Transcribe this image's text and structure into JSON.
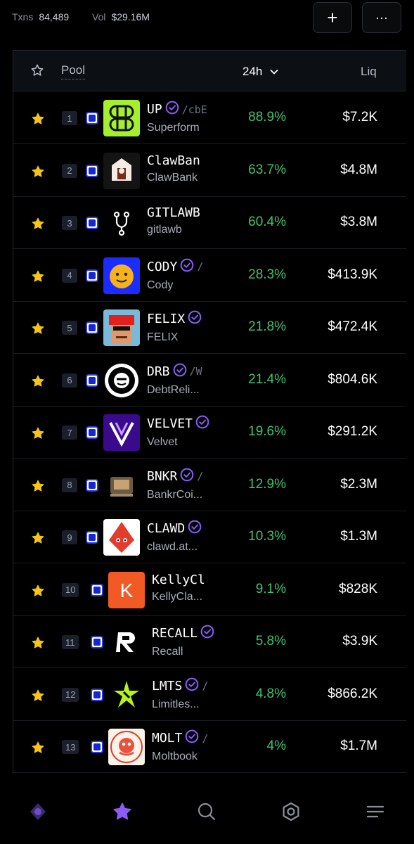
{
  "stats": {
    "txns_label": "Txns",
    "txns_value": "84,489",
    "vol_label": "Vol",
    "vol_value": "$29.16M"
  },
  "buttons": {
    "add": "+",
    "more": "···"
  },
  "table": {
    "col_pool": "Pool",
    "col_change": "24h",
    "col_liq": "Liq"
  },
  "rows": [
    {
      "rank": "1",
      "symbol": "UP",
      "verified": true,
      "suffix": "/cbE",
      "name": "Superform",
      "change": "88.9%",
      "liq": "$7.2K"
    },
    {
      "rank": "2",
      "symbol": "ClawBan",
      "verified": false,
      "suffix": "",
      "name": "ClawBank",
      "change": "63.7%",
      "liq": "$4.8M"
    },
    {
      "rank": "3",
      "symbol": "GITLAWB",
      "verified": false,
      "suffix": "",
      "name": "gitlawb",
      "change": "60.4%",
      "liq": "$3.8M"
    },
    {
      "rank": "4",
      "symbol": "CODY",
      "verified": true,
      "suffix": "/",
      "name": "Cody",
      "change": "28.3%",
      "liq": "$413.9K"
    },
    {
      "rank": "5",
      "symbol": "FELIX",
      "verified": true,
      "suffix": "",
      "name": "FELIX",
      "change": "21.8%",
      "liq": "$472.4K"
    },
    {
      "rank": "6",
      "symbol": "DRB",
      "verified": true,
      "suffix": "/W",
      "name": "DebtReli...",
      "change": "21.4%",
      "liq": "$804.6K"
    },
    {
      "rank": "7",
      "symbol": "VELVET",
      "verified": true,
      "suffix": "",
      "name": "Velvet",
      "change": "19.6%",
      "liq": "$291.2K"
    },
    {
      "rank": "8",
      "symbol": "BNKR",
      "verified": true,
      "suffix": "/",
      "name": "BankrCoi...",
      "change": "12.9%",
      "liq": "$2.3M"
    },
    {
      "rank": "9",
      "symbol": "CLAWD",
      "verified": true,
      "suffix": "",
      "name": "clawd.at...",
      "change": "10.3%",
      "liq": "$1.3M"
    },
    {
      "rank": "10",
      "symbol": "KellyCl",
      "verified": false,
      "suffix": "",
      "name": "KellyCla...",
      "change": "9.1%",
      "liq": "$828K"
    },
    {
      "rank": "11",
      "symbol": "RECALL",
      "verified": true,
      "suffix": "",
      "name": "Recall",
      "change": "5.8%",
      "liq": "$3.9K"
    },
    {
      "rank": "12",
      "symbol": "LMTS",
      "verified": true,
      "suffix": "/",
      "name": "Limitles...",
      "change": "4.8%",
      "liq": "$866.2K"
    },
    {
      "rank": "13",
      "symbol": "MOLT",
      "verified": true,
      "suffix": "/",
      "name": "Moltbook",
      "change": "4%",
      "liq": "$1.7M"
    }
  ],
  "colors": {
    "positive": "#3ec46d",
    "accent": "#8b5cf6",
    "star": "#f5c518"
  },
  "nav": [
    "home-icon",
    "watchlist-icon",
    "search-icon",
    "settings-icon",
    "menu-icon"
  ]
}
